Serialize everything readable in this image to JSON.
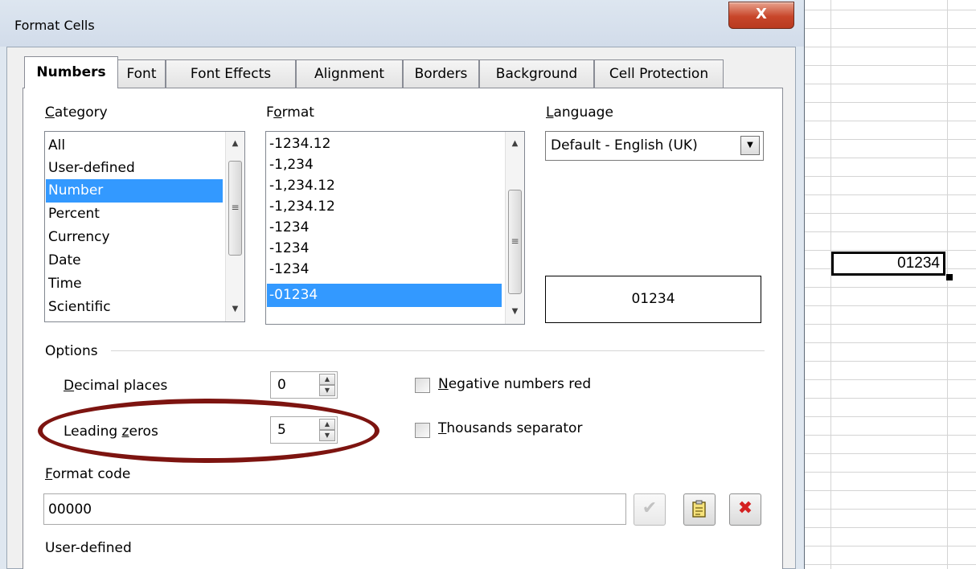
{
  "dialog": {
    "title": "Format Cells",
    "close_label": "X",
    "tabs": [
      {
        "label": "Numbers",
        "active": true
      },
      {
        "label": "Font"
      },
      {
        "label": "Font Effects"
      },
      {
        "label": "Alignment"
      },
      {
        "label": "Borders"
      },
      {
        "label": "Background"
      },
      {
        "label": "Cell Protection"
      }
    ]
  },
  "category": {
    "label_mnemonic": "C",
    "label_rest": "ategory",
    "items": [
      "All",
      "User-defined",
      "Number",
      "Percent",
      "Currency",
      "Date",
      "Time",
      "Scientific"
    ],
    "selected": "Number"
  },
  "format": {
    "label_pre": "F",
    "label_mnemonic": "o",
    "label_rest": "rmat",
    "items": [
      "-1234.12",
      "-1,234",
      "-1,234.12",
      "-1,234.12",
      "-1234",
      "-1234",
      "-1234",
      "-01234"
    ],
    "selected": "-01234"
  },
  "language": {
    "label_mnemonic": "L",
    "label_rest": "anguage",
    "value": "Default - English (UK)"
  },
  "preview": {
    "value": "01234"
  },
  "options": {
    "title": "Options",
    "decimal_places": {
      "label_mnemonic": "D",
      "label_rest": "ecimal places",
      "value": "0"
    },
    "leading_zeros": {
      "label_pre": "Leading ",
      "label_mnemonic": "z",
      "label_rest": "eros",
      "value": "5"
    },
    "negative_red": {
      "label_mnemonic": "N",
      "label_rest": "egative numbers red",
      "checked": false
    },
    "thousands_sep": {
      "label_mnemonic": "T",
      "label_rest": "housands separator",
      "checked": false
    }
  },
  "format_code": {
    "label_mnemonic": "F",
    "label_rest": "ormat code",
    "value": "00000",
    "description": "User-defined"
  },
  "spreadsheet": {
    "cell_value": "01234"
  },
  "colors": {
    "selection": "#3399ff",
    "highlight_ellipse": "#7d1410",
    "close_button": "#c8462a",
    "delete_icon": "#d42020",
    "accept_icon": "#9a9a9a"
  },
  "icons": {
    "accept": "check-icon",
    "edit_comment": "note-edit-icon",
    "delete": "delete-x-icon"
  }
}
